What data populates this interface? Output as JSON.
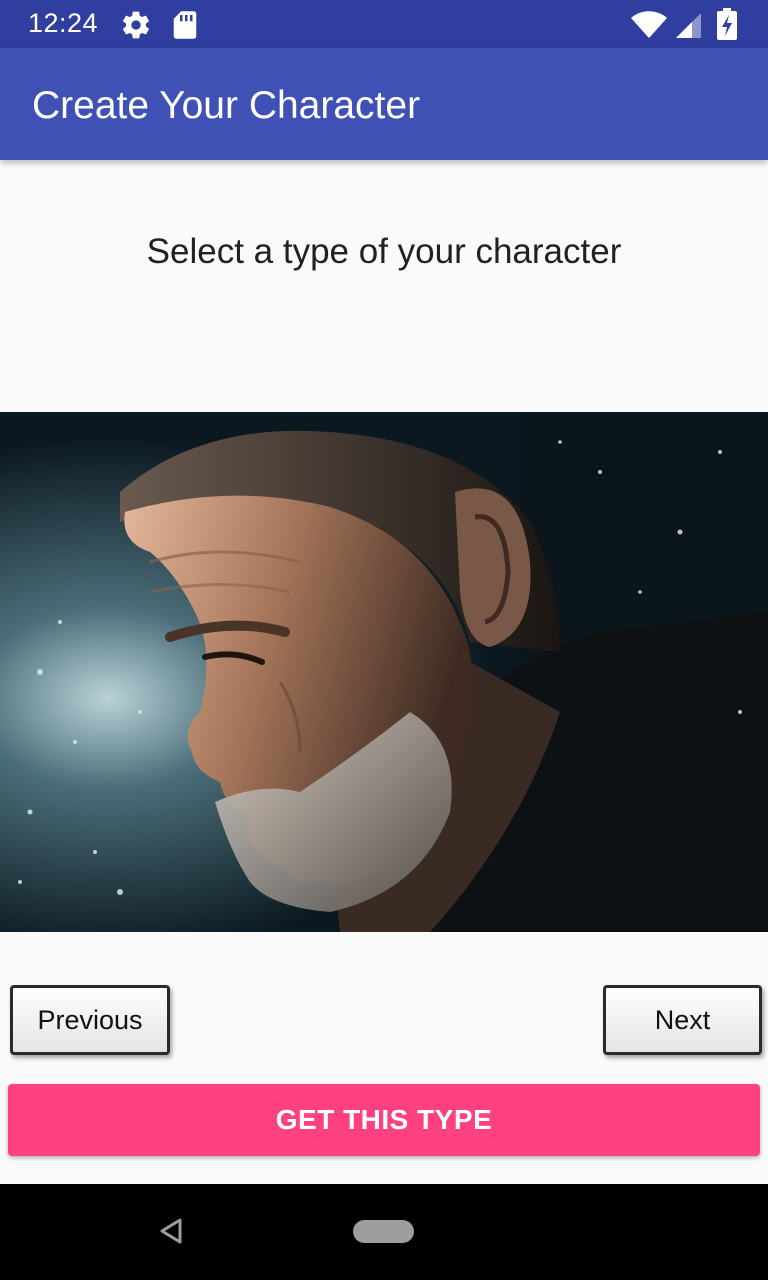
{
  "status_bar": {
    "time": "12:24",
    "icons": [
      "gear-icon",
      "sd-card-icon",
      "wifi-icon",
      "signal-icon",
      "battery-icon"
    ]
  },
  "app_bar": {
    "title": "Create Your Character",
    "color": "#3f51b5",
    "status_color": "#303f9f"
  },
  "content": {
    "prompt": "Select a type of your character"
  },
  "buttons": {
    "previous": "Previous",
    "next": "Next",
    "get_type": "GET THIS TYPE",
    "accent_color": "#ff4081"
  },
  "system_nav": {
    "icons": [
      "back-icon",
      "home-pill-icon"
    ]
  }
}
